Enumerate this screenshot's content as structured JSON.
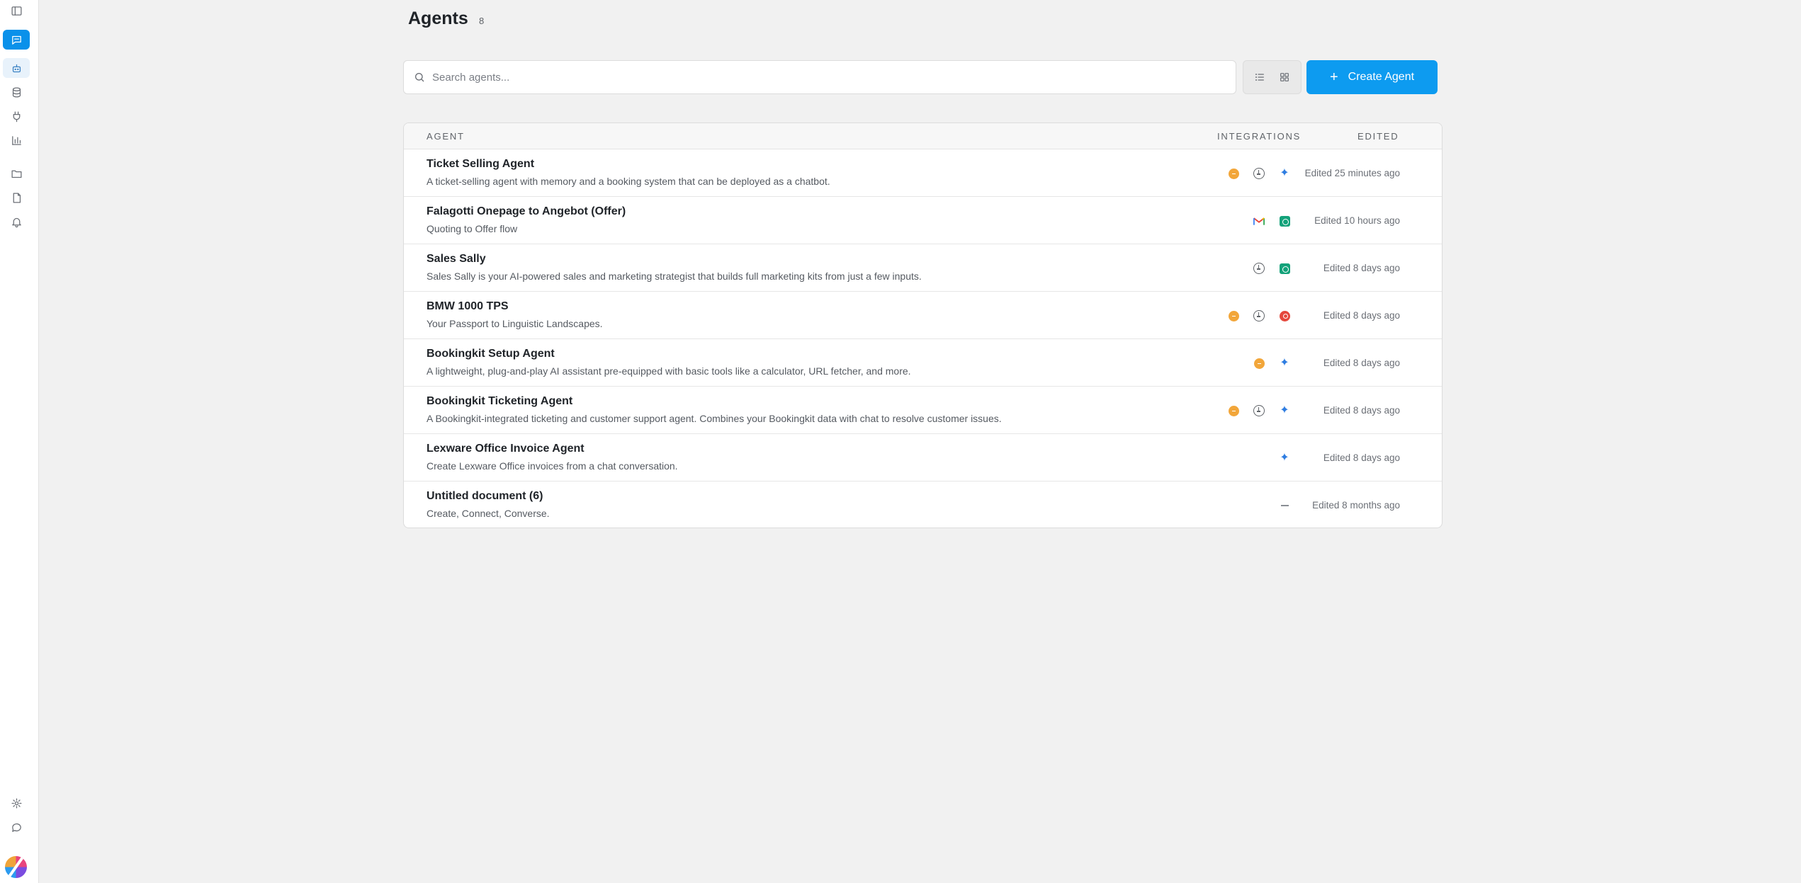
{
  "page": {
    "title": "Agents",
    "count": "8"
  },
  "search": {
    "placeholder": "Search agents...",
    "value": ""
  },
  "toolbar": {
    "create_label": "Create Agent",
    "create_plus": "+",
    "view_modes": [
      "list-icon",
      "grid-icon"
    ]
  },
  "sidebar": {
    "top": [
      "sidebar-toggle-icon",
      "chat-icon",
      "bot-icon",
      "database-icon",
      "plug-icon",
      "chart-icon",
      "folder-icon",
      "file-icon",
      "bell-icon"
    ],
    "bottom": [
      "settings-icon",
      "message-icon",
      "avatar"
    ]
  },
  "table": {
    "headers": {
      "agent": "Agent",
      "integrations": "Integrations",
      "edited": "Edited"
    },
    "rows": [
      {
        "name": "Ticket Selling Agent",
        "description": "A ticket-selling agent with memory and a booking system that can be deployed as a chatbot.",
        "integrations": [
          "orange-dot-icon",
          "clock-icon",
          "sparkle-icon"
        ],
        "edited": "Edited 25 minutes ago"
      },
      {
        "name": "Falagotti Onepage to Angebot (Offer)",
        "description": "Quoting to Offer flow",
        "integrations": [
          "gmail-icon",
          "green-app-icon"
        ],
        "edited": "Edited 10 hours ago"
      },
      {
        "name": "Sales Sally",
        "description": "Sales Sally is your AI-powered sales and marketing strategist that builds full marketing kits from just a few inputs.",
        "integrations": [
          "clock-icon",
          "green-app-icon"
        ],
        "edited": "Edited 8 days ago"
      },
      {
        "name": "BMW 1000 TPS",
        "description": "Your Passport to Linguistic Landscapes.",
        "integrations": [
          "orange-dot-icon",
          "clock-icon",
          "red-app-icon"
        ],
        "edited": "Edited 8 days ago"
      },
      {
        "name": "Bookingkit Setup Agent",
        "description": "A lightweight, plug-and-play AI assistant pre-equipped with basic tools like a calculator, URL fetcher, and more.",
        "integrations": [
          "orange-dot-icon",
          "sparkle-icon"
        ],
        "edited": "Edited 8 days ago"
      },
      {
        "name": "Bookingkit Ticketing Agent",
        "description": "A Bookingkit-integrated ticketing and customer support agent. Combines your Bookingkit data with chat to resolve customer issues.",
        "integrations": [
          "orange-dot-icon",
          "clock-icon",
          "sparkle-icon"
        ],
        "edited": "Edited 8 days ago"
      },
      {
        "name": "Lexware Office Invoice Agent",
        "description": "Create Lexware Office invoices from a chat conversation.",
        "integrations": [
          "sparkle-icon"
        ],
        "edited": "Edited 8 days ago"
      },
      {
        "name": "Untitled document (6)",
        "description": "Create, Connect, Converse.",
        "integrations": [
          "dash-icon"
        ],
        "edited": "Edited 8 months ago"
      }
    ]
  }
}
